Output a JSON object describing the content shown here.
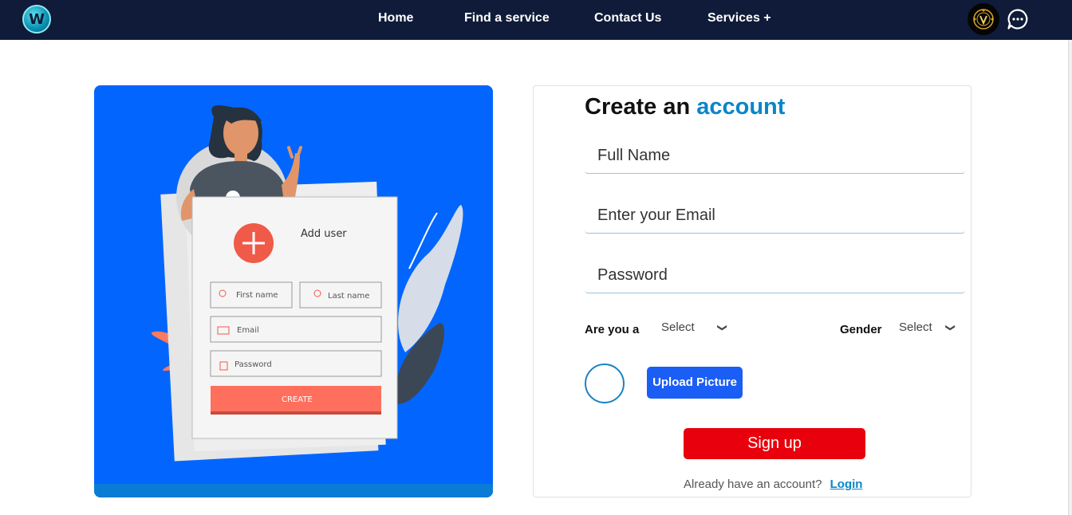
{
  "nav": {
    "logo_letter": "W",
    "links": [
      {
        "label": "Home"
      },
      {
        "label": "Find a service"
      },
      {
        "label": "Contact Us"
      },
      {
        "label": "Services +"
      }
    ]
  },
  "illustration": {
    "card_title": "Add user",
    "first_name": "First name",
    "last_name": "Last name",
    "email": "Email",
    "password": "Password",
    "create": "CREATE"
  },
  "form": {
    "heading_main": "Create an",
    "heading_accent": "account",
    "full_name_placeholder": "Full Name",
    "email_placeholder": "Enter your Email",
    "password_placeholder": "Password",
    "are_you_label": "Are you a",
    "are_you_value": "Select",
    "gender_label": "Gender",
    "gender_value": "Select",
    "upload_label": "Upload Picture",
    "signup_label": "Sign up",
    "login_prompt": "Already have an account?",
    "login_link": "Login"
  },
  "colors": {
    "navbar": "#0f1b38",
    "illustration_bg": "#0266fe",
    "accent": "#0a86c8",
    "upload": "#1a5ef5",
    "signup": "#e8000c"
  },
  "icons": {
    "chat": "chat-bubble-icon",
    "avatar": "profile-avatar-icon"
  }
}
